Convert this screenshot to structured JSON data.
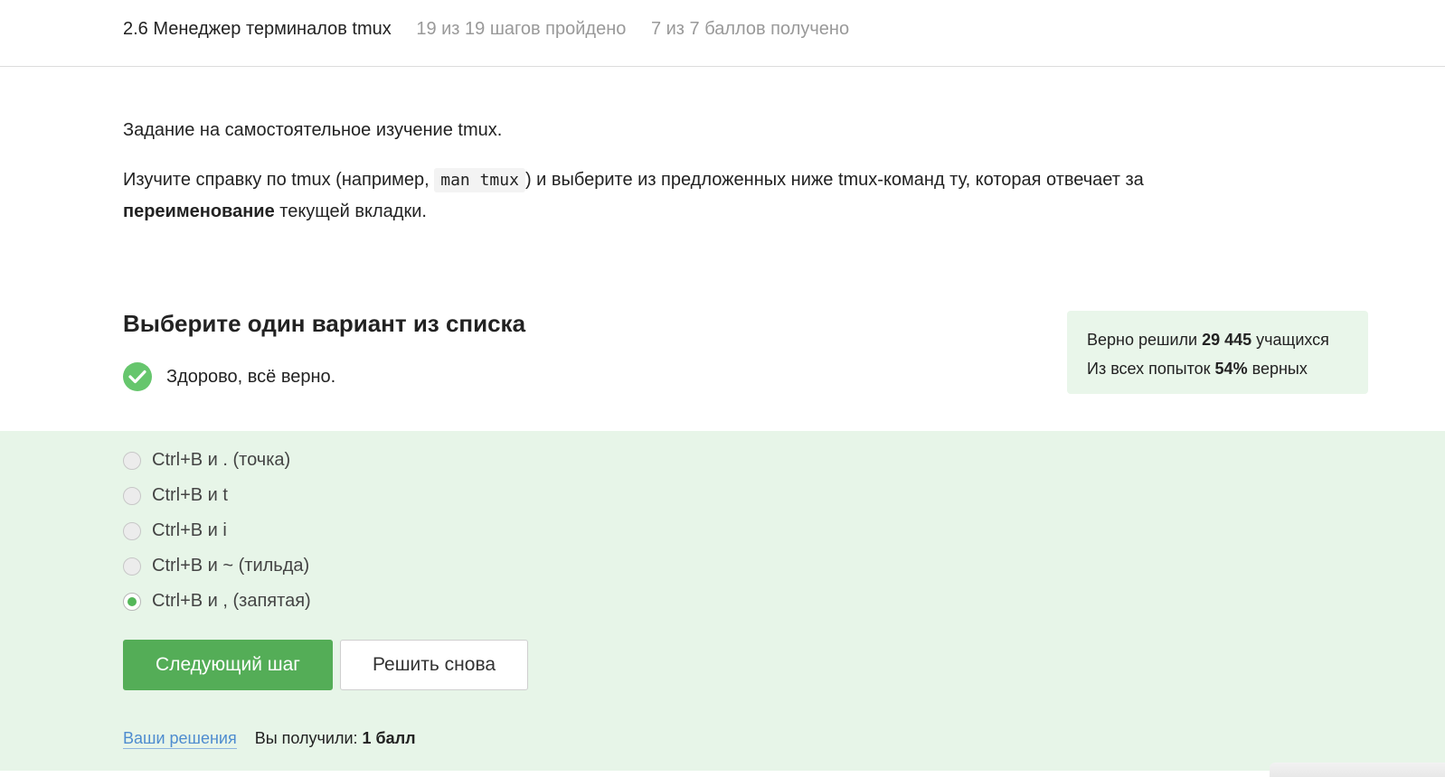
{
  "header": {
    "lesson_title": "2.6 Менеджер терминалов tmux",
    "steps_progress": "19 из 19 шагов пройдено",
    "points_progress": "7 из 7 баллов  получено"
  },
  "task": {
    "intro": "Задание на самостоятельное изучение tmux.",
    "text_before_code": "Изучите справку по tmux (например, ",
    "code": "man tmux",
    "text_after_code": ") и выберите из предложенных ниже tmux-команд ту, которая отвечает за ",
    "bold_word": "переименование",
    "text_end": " текущей вкладки."
  },
  "quiz": {
    "title": "Выберите один вариант из списка",
    "feedback": "Здорово, всё верно.",
    "options": [
      {
        "label": "Ctrl+B и . (точка)",
        "checked": false
      },
      {
        "label": "Ctrl+B и t",
        "checked": false
      },
      {
        "label": "Ctrl+B и i",
        "checked": false
      },
      {
        "label": "Ctrl+B и ~ (тильда)",
        "checked": false
      },
      {
        "label": "Ctrl+B и , (запятая)",
        "checked": true
      }
    ]
  },
  "stats": {
    "solved_prefix": "Верно решили ",
    "solved_count": "29 445",
    "solved_suffix": " учащихся",
    "attempts_prefix": "Из всех попыток ",
    "attempts_percent": "54%",
    "attempts_suffix": " верных"
  },
  "buttons": {
    "next": "Следующий шаг",
    "retry": "Решить снова"
  },
  "footer": {
    "solutions_link": "Ваши решения",
    "score_prefix": "Вы получили: ",
    "score_value": "1 балл"
  },
  "colors": {
    "accent_green": "#54ad57",
    "answer_background": "#e7f5e8",
    "link_blue": "#4e8ccf"
  },
  "icons": {
    "feedback_icon": "check-circle-icon"
  }
}
